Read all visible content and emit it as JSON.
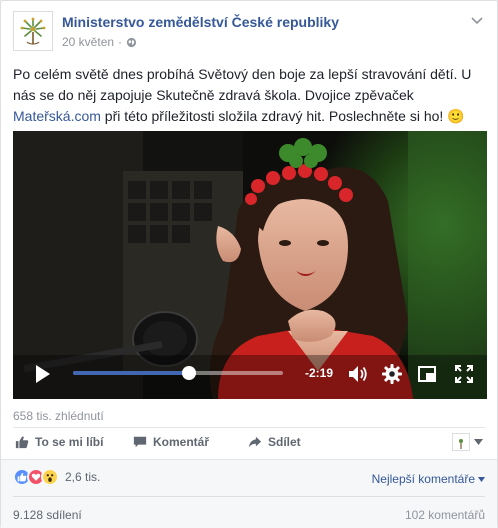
{
  "post": {
    "page_name": "Ministerstvo zemědělství České republiky",
    "date": "20 květen",
    "separator": "·",
    "text_before_link": "Po celém světě dnes probíhá Světový den boje za lepší stravování dětí. U nás se do něj zapojuje Skutečně zdravá škola. Dvojice zpěvaček ",
    "link_text": "Mateřská.com",
    "text_after_link": " při této příležitosti složila zdravý hit. Poslechněte si ho! 🙂"
  },
  "video": {
    "progress": 0.55,
    "time_remaining": "-2:19",
    "play_icon": "play-icon",
    "volume_icon": "volume-icon",
    "settings_icon": "gear-icon",
    "pip_icon": "picture-in-picture-icon",
    "fullscreen_icon": "fullscreen-icon"
  },
  "views": "658 tis. zhlédnutí",
  "actions": {
    "like": "To se mi líbí",
    "comment": "Komentář",
    "share": "Sdílet"
  },
  "summary": {
    "reaction_count": "2,6 tis.",
    "sort": "Nejlepší komentáře",
    "shares": "9.128 sdílení",
    "comments": "102 komentářů"
  },
  "colors": {
    "link": "#365899",
    "like_blue": "#5890ff",
    "love_red": "#f25268",
    "wow_yellow": "#fcd34d",
    "progress_blue": "#4267b2"
  }
}
